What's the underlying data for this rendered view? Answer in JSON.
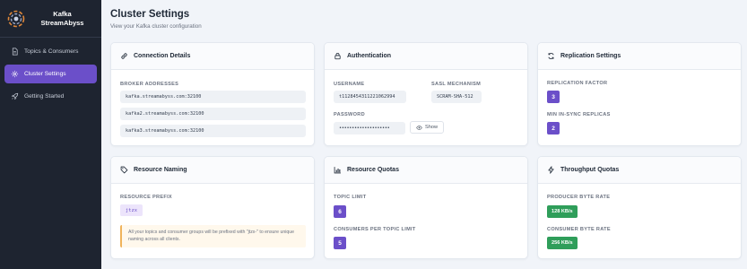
{
  "app": {
    "name_line1": "Kafka",
    "name_line2": "StreamAbyss"
  },
  "sidebar": {
    "items": [
      {
        "label": "Topics & Consumers",
        "icon": "document-icon",
        "active": false
      },
      {
        "label": "Cluster Settings",
        "icon": "gear-icon",
        "active": true
      },
      {
        "label": "Getting Started",
        "icon": "rocket-icon",
        "active": false
      }
    ]
  },
  "header": {
    "title": "Cluster Settings",
    "subtitle": "View your Kafka cluster configuration"
  },
  "connection": {
    "title": "Connection Details",
    "broker_label": "BROKER ADDRESSES",
    "brokers": [
      "kafka.streamabyss.com:32100",
      "kafka2.streamabyss.com:32100",
      "kafka3.streamabyss.com:32100"
    ]
  },
  "auth": {
    "title": "Authentication",
    "username_label": "USERNAME",
    "username": "t1128454311221062994",
    "sasl_label": "SASL MECHANISM",
    "sasl": "SCRAM-SHA-512",
    "password_label": "PASSWORD",
    "password_mask": "••••••••••••••••••••",
    "show_label": "Show"
  },
  "replication": {
    "title": "Replication Settings",
    "factor_label": "REPLICATION FACTOR",
    "factor": "3",
    "min_isr_label": "MIN IN-SYNC REPLICAS",
    "min_isr": "2"
  },
  "naming": {
    "title": "Resource Naming",
    "prefix_label": "RESOURCE PREFIX",
    "prefix": "jtzx",
    "note": "All your topics and consumer groups will be prefixed with \"jtzx-\" to ensure unique naming across all clients."
  },
  "quotas": {
    "title": "Resource Quotas",
    "topic_limit_label": "TOPIC LIMIT",
    "topic_limit": "6",
    "consumers_label": "CONSUMERS PER TOPIC LIMIT",
    "consumers": "5"
  },
  "throughput": {
    "title": "Throughput Quotas",
    "producer_label": "PRODUCER BYTE RATE",
    "producer": "128 KB/s",
    "consumer_label": "CONSUMER BYTE RATE",
    "consumer": "256 KB/s"
  },
  "colors": {
    "accent": "#6b4fc9",
    "success": "#2f9e5a",
    "sidebar": "#1e2430"
  }
}
